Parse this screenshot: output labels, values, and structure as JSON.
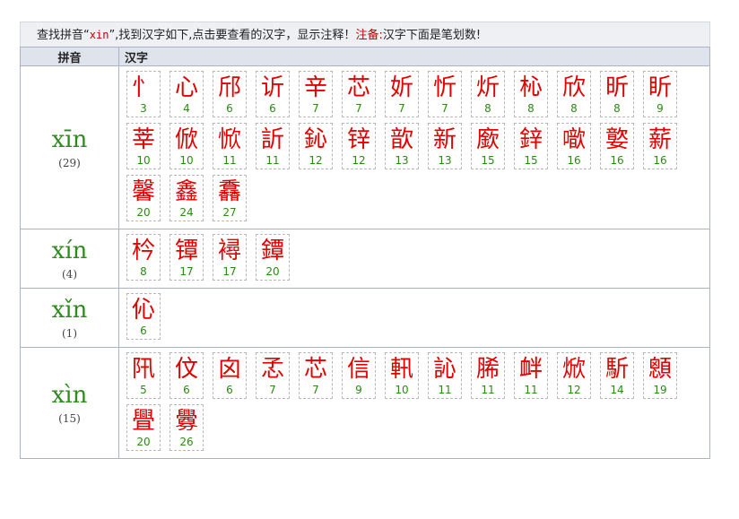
{
  "notice": {
    "prefix": "查找拼音“",
    "keyword": "xin",
    "middle": "”,找到汉字如下,点击要查看的汉字，显示注释！",
    "note_label": "注备:",
    "suffix": "汉字下面是笔划数!"
  },
  "headers": {
    "pinyin": "拼音",
    "hanzi": "汉字"
  },
  "groups": [
    {
      "pinyin": "xīn",
      "count": "(29)",
      "chars": [
        {
          "c": "忄",
          "s": "3"
        },
        {
          "c": "心",
          "s": "4"
        },
        {
          "c": "邤",
          "s": "6"
        },
        {
          "c": "䜣",
          "s": "6"
        },
        {
          "c": "辛",
          "s": "7"
        },
        {
          "c": "芯",
          "s": "7"
        },
        {
          "c": "妡",
          "s": "7"
        },
        {
          "c": "忻",
          "s": "7"
        },
        {
          "c": "炘",
          "s": "8"
        },
        {
          "c": "杺",
          "s": "8"
        },
        {
          "c": "欣",
          "s": "8"
        },
        {
          "c": "昕",
          "s": "8"
        },
        {
          "c": "盺",
          "s": "9"
        },
        {
          "c": "莘",
          "s": "10"
        },
        {
          "c": "俽",
          "s": "10"
        },
        {
          "c": "惞",
          "s": "11"
        },
        {
          "c": "訢",
          "s": "11"
        },
        {
          "c": "鈊",
          "s": "12"
        },
        {
          "c": "锌",
          "s": "12"
        },
        {
          "c": "歆",
          "s": "13"
        },
        {
          "c": "新",
          "s": "13"
        },
        {
          "c": "廞",
          "s": "15"
        },
        {
          "c": "鋅",
          "s": "15"
        },
        {
          "c": "噷",
          "s": "16"
        },
        {
          "c": "嬜",
          "s": "16"
        },
        {
          "c": "薪",
          "s": "16"
        },
        {
          "c": "馨",
          "s": "20"
        },
        {
          "c": "鑫",
          "s": "24"
        },
        {
          "c": "馫",
          "s": "27"
        }
      ]
    },
    {
      "pinyin": "xín",
      "count": "(4)",
      "chars": [
        {
          "c": "枔",
          "s": "8"
        },
        {
          "c": "镡",
          "s": "17"
        },
        {
          "c": "襑",
          "s": "17"
        },
        {
          "c": "鐔",
          "s": "20"
        }
      ]
    },
    {
      "pinyin": "xǐn",
      "count": "(1)",
      "chars": [
        {
          "c": "伈",
          "s": "6"
        }
      ]
    },
    {
      "pinyin": "xìn",
      "count": "(15)",
      "chars": [
        {
          "c": "阠",
          "s": "5"
        },
        {
          "c": "伩",
          "s": "6"
        },
        {
          "c": "囟",
          "s": "6"
        },
        {
          "c": "孞",
          "s": "7"
        },
        {
          "c": "芯",
          "s": "7"
        },
        {
          "c": "信",
          "s": "9"
        },
        {
          "c": "軐",
          "s": "10"
        },
        {
          "c": "訫",
          "s": "11"
        },
        {
          "c": "脪",
          "s": "11"
        },
        {
          "c": "衅",
          "s": "11"
        },
        {
          "c": "焮",
          "s": "12"
        },
        {
          "c": "馸",
          "s": "14"
        },
        {
          "c": "顖",
          "s": "19"
        },
        {
          "c": "舋",
          "s": "20"
        },
        {
          "c": "釁",
          "s": "26"
        }
      ]
    }
  ]
}
